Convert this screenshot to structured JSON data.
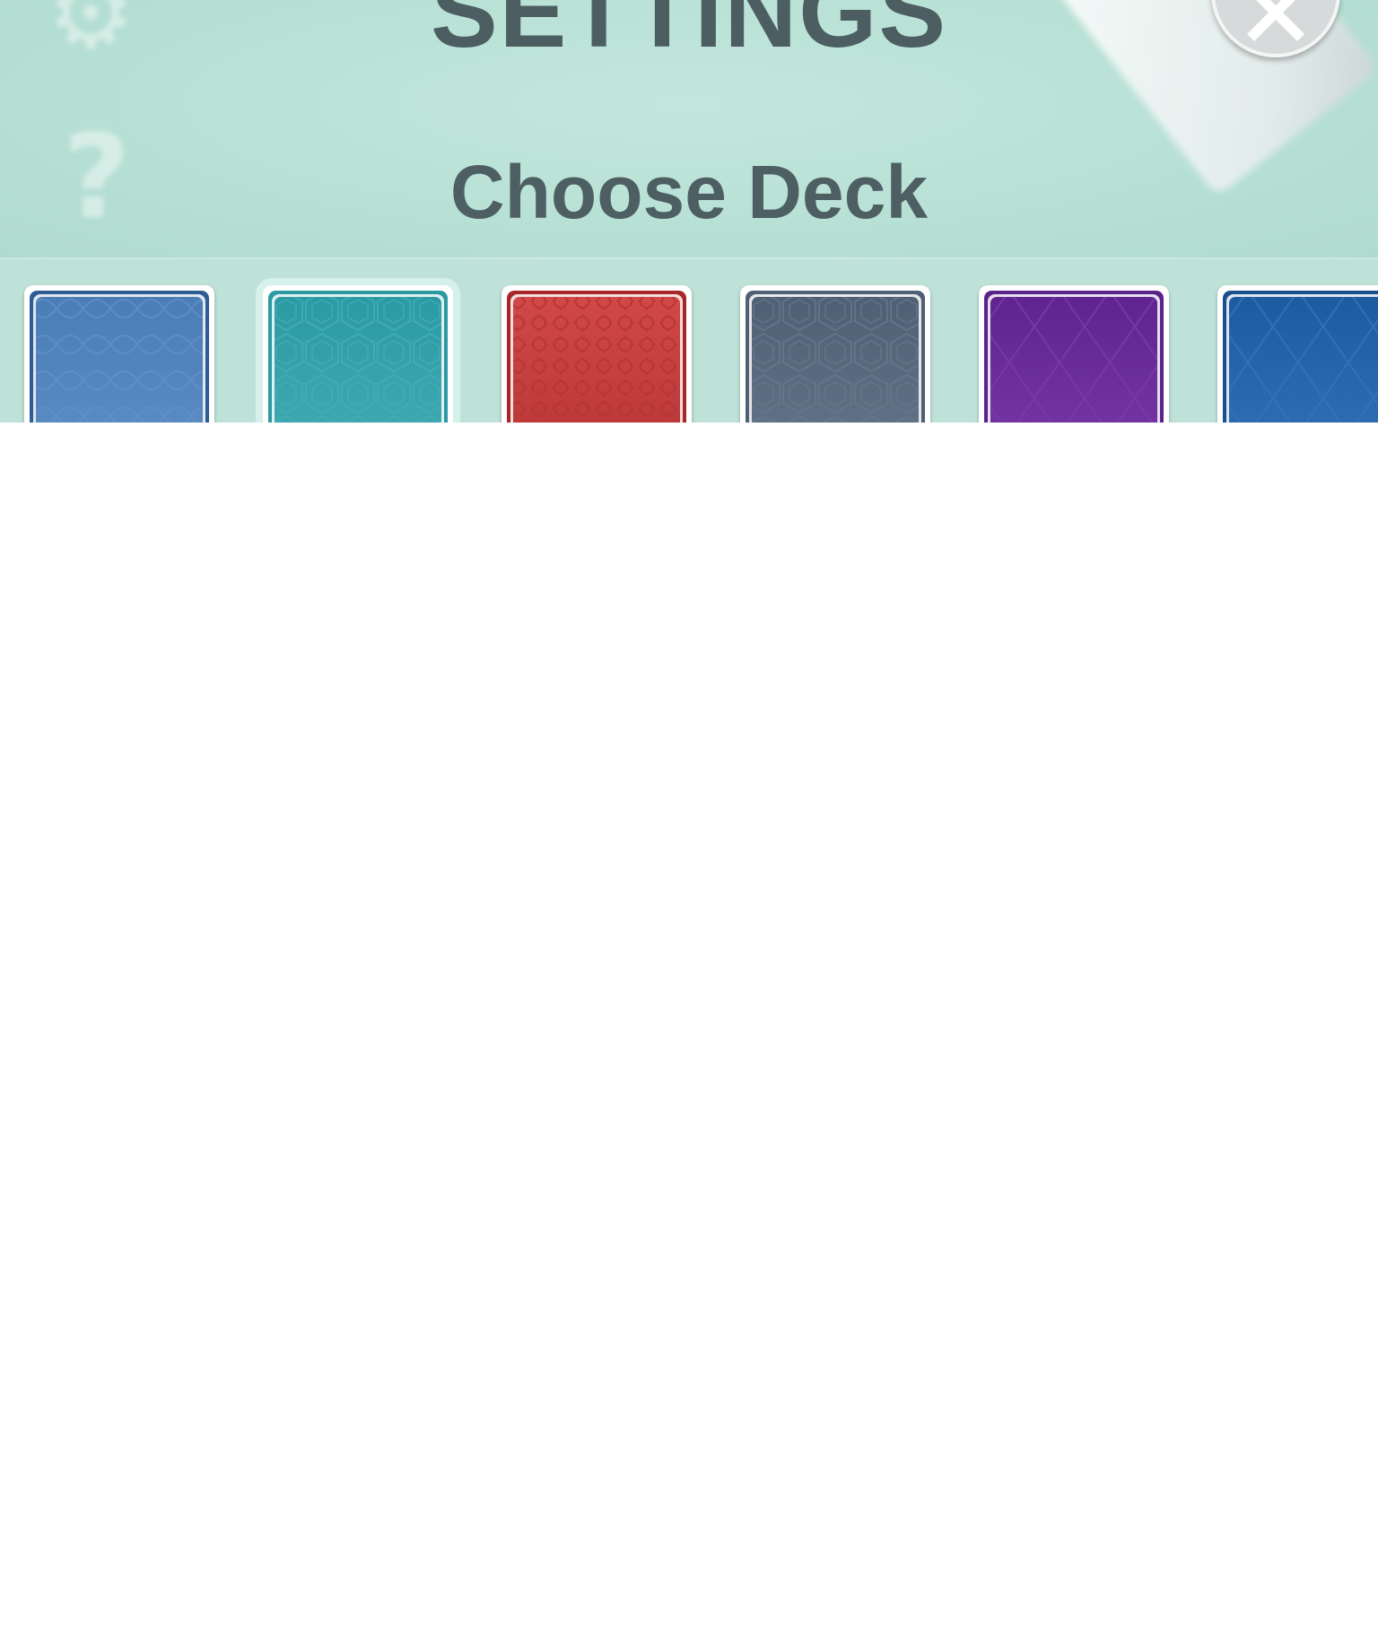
{
  "header": {
    "title": "SETTINGS",
    "subtitle": "Choose Deck"
  },
  "close_button": {
    "icon": "close-icon"
  },
  "background_icons": [
    "gear-icon",
    "question-icon"
  ],
  "decks": [
    {
      "id": "deck-blue-waves",
      "color": "#4a7cb6",
      "accent": "#5f90c6",
      "border": "#2e5c94",
      "pattern": "waves",
      "selected": false
    },
    {
      "id": "deck-teal-hex",
      "color": "#2c9aa3",
      "accent": "#43adb5",
      "border": "#2c9aa3",
      "pattern": "hexagons",
      "selected": true
    },
    {
      "id": "deck-red-tiles",
      "color": "#d14848",
      "accent": "#b53434",
      "border": "#a82626",
      "pattern": "tiles",
      "selected": false
    },
    {
      "id": "deck-slate-hex",
      "color": "#4f5f74",
      "accent": "#66778c",
      "border": "#4f5f74",
      "pattern": "hexagons",
      "selected": false
    },
    {
      "id": "deck-purple-diamond",
      "color": "#5f2490",
      "accent": "#7a3aa8",
      "border": "#5a2389",
      "pattern": "diamonds",
      "selected": false
    },
    {
      "id": "deck-navy-diamond",
      "color": "#1e5aa0",
      "accent": "#3473b8",
      "border": "#1a4f8f",
      "pattern": "diamonds",
      "selected": false
    }
  ]
}
